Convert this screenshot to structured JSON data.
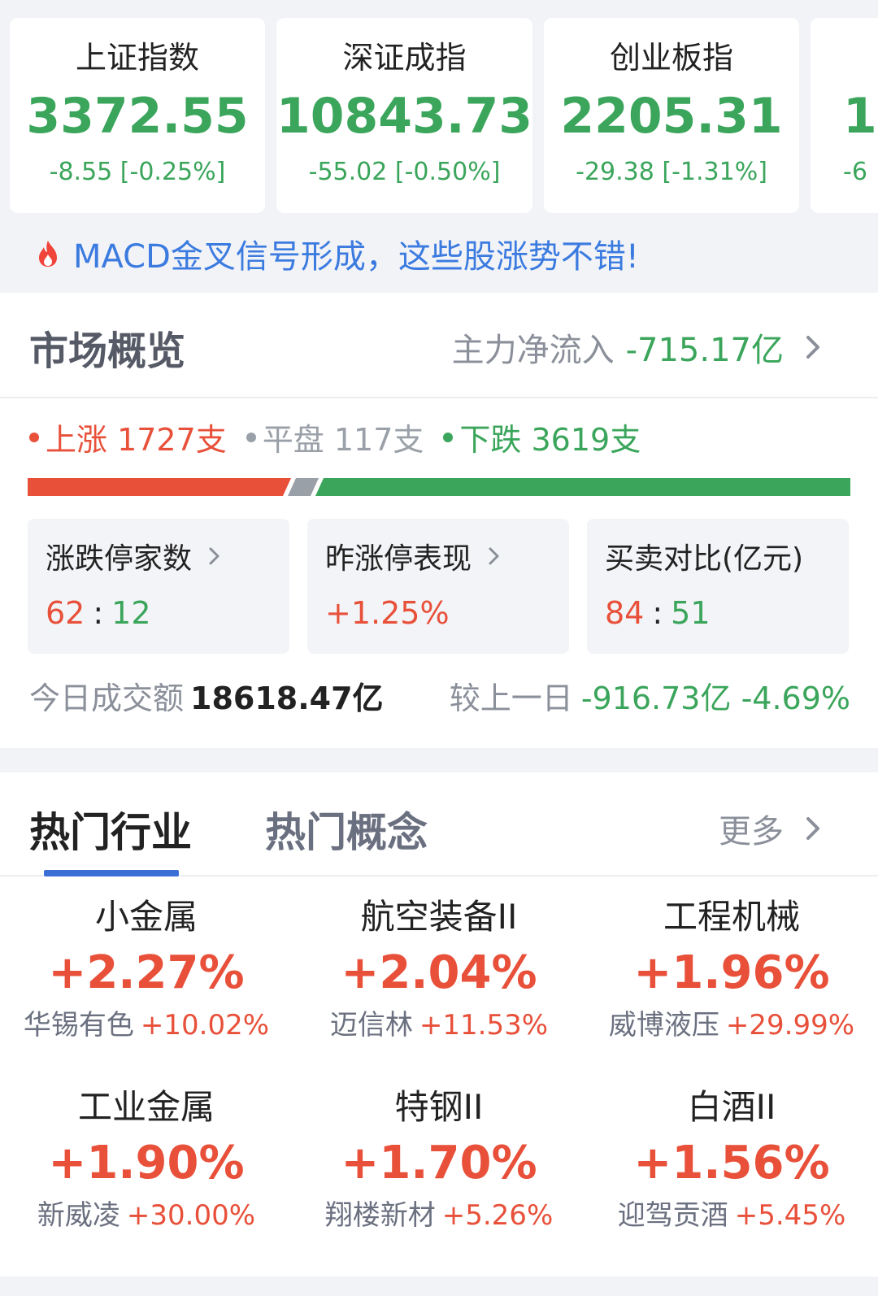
{
  "indices": [
    {
      "name": "上证指数",
      "value": "3372.55",
      "change": "-8.55 [-0.25%]"
    },
    {
      "name": "深证成指",
      "value": "10843.73",
      "change": "-55.02 [-0.50%]"
    },
    {
      "name": "创业板指",
      "value": "2205.31",
      "change": "-29.38 [-1.31%]"
    },
    {
      "name": "",
      "value": "1",
      "change": "-6"
    }
  ],
  "promo": {
    "text": "MACD金叉信号形成，这些股涨势不错!"
  },
  "overview": {
    "title": "市场概览",
    "flow_label": "主力净流入",
    "flow_value": "-715.17亿",
    "up_label": "上涨 1727支",
    "flat_label": "平盘 117支",
    "down_label": "下跌 3619支",
    "bar": {
      "up": 1727,
      "flat": 117,
      "down": 3619
    },
    "cards": [
      {
        "title": "涨跌停家数",
        "left": "62",
        "sep": ":",
        "right": "12"
      },
      {
        "title": "昨涨停表现",
        "value": "+1.25%"
      },
      {
        "title": "买卖对比(亿元)",
        "left": "84",
        "sep": ":",
        "right": "51"
      }
    ],
    "turnover_label": "今日成交额",
    "turnover_value": "18618.47亿",
    "compare_label": "较上一日",
    "compare_value": "-916.73亿 -4.69%"
  },
  "sectors": {
    "tab_active": "热门行业",
    "tab_inactive": "热门概念",
    "more": "更多",
    "items": [
      {
        "name": "小金属",
        "pct": "+2.27%",
        "leader": "华锡有色",
        "leader_pct": "+10.02%"
      },
      {
        "name": "航空装备II",
        "pct": "+2.04%",
        "leader": "迈信林",
        "leader_pct": "+11.53%"
      },
      {
        "name": "工程机械",
        "pct": "+1.96%",
        "leader": "威博液压",
        "leader_pct": "+29.99%"
      },
      {
        "name": "工业金属",
        "pct": "+1.90%",
        "leader": "新威凌",
        "leader_pct": "+30.00%"
      },
      {
        "name": "特钢II",
        "pct": "+1.70%",
        "leader": "翔楼新材",
        "leader_pct": "+5.26%"
      },
      {
        "name": "白酒II",
        "pct": "+1.56%",
        "leader": "迎驾贡酒",
        "leader_pct": "+5.45%"
      }
    ]
  },
  "colors": {
    "up": "#e8503a",
    "down": "#3aa55b",
    "flat": "#9aa0a8",
    "accent": "#3b6fd6"
  }
}
